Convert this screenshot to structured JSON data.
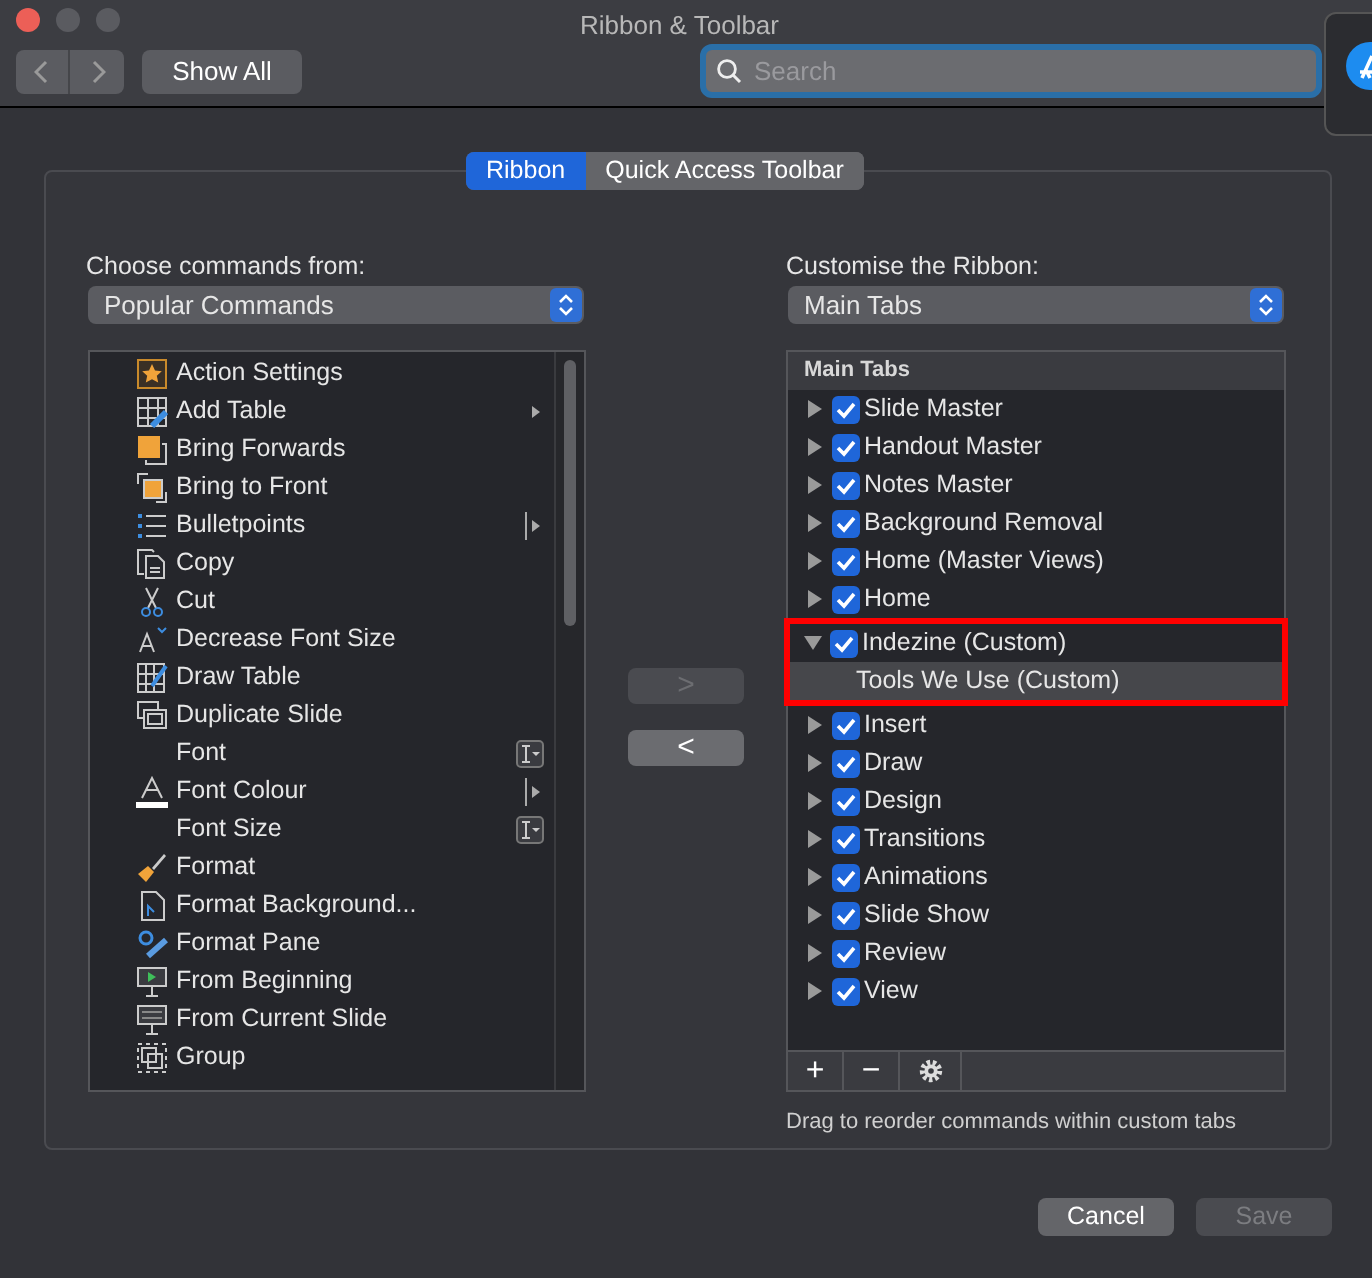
{
  "window": {
    "title": "Ribbon & Toolbar"
  },
  "toolbar": {
    "show_all": "Show All",
    "search": {
      "placeholder": "Search"
    }
  },
  "tabs": [
    {
      "label": "Ribbon",
      "selected": true
    },
    {
      "label": "Quick Access Toolbar",
      "selected": false
    }
  ],
  "left": {
    "label": "Choose commands from:",
    "dropdown": "Popular Commands",
    "commands": [
      {
        "label": "Action Settings",
        "kind": "plain",
        "selected": false
      },
      {
        "label": "Add Table",
        "kind": "submenu",
        "selected": false
      },
      {
        "label": "Bring Forwards",
        "kind": "plain",
        "selected": false
      },
      {
        "label": "Bring to Front",
        "kind": "plain",
        "selected": false
      },
      {
        "label": "Bulletpoints",
        "kind": "split",
        "selected": false
      },
      {
        "label": "Copy",
        "kind": "plain",
        "selected": false
      },
      {
        "label": "Cut",
        "kind": "plain",
        "selected": false
      },
      {
        "label": "Decrease Font Size",
        "kind": "plain",
        "selected": false
      },
      {
        "label": "Draw Table",
        "kind": "plain",
        "selected": false
      },
      {
        "label": "Duplicate Slide",
        "kind": "plain",
        "selected": false
      },
      {
        "label": "Font",
        "kind": "combo",
        "selected": false
      },
      {
        "label": "Font Colour",
        "kind": "split",
        "selected": false
      },
      {
        "label": "Font Size",
        "kind": "combo",
        "selected": false
      },
      {
        "label": "Format",
        "kind": "plain",
        "selected": false
      },
      {
        "label": "Format Background...",
        "kind": "plain",
        "selected": false
      },
      {
        "label": "Format Pane",
        "kind": "plain",
        "selected": false
      },
      {
        "label": "From Beginning",
        "kind": "plain",
        "selected": false
      },
      {
        "label": "From Current Slide",
        "kind": "plain",
        "selected": false
      },
      {
        "label": "Group",
        "kind": "plain",
        "selected": false
      }
    ]
  },
  "move_buttons": [
    {
      "label": ">",
      "disabled": true
    },
    {
      "label": "<",
      "disabled": false
    }
  ],
  "right": {
    "label": "Customise the Ribbon:",
    "dropdown": "Main Tabs",
    "header": "Main Tabs",
    "tabs": [
      {
        "label": "Slide Master",
        "checked": true,
        "expanded": false,
        "outlined": false,
        "selected": false
      },
      {
        "label": "Handout Master",
        "checked": true,
        "expanded": false,
        "outlined": false,
        "selected": false
      },
      {
        "label": "Notes Master",
        "checked": true,
        "expanded": false,
        "outlined": false,
        "selected": false
      },
      {
        "label": "Background Removal",
        "checked": true,
        "expanded": false,
        "outlined": false,
        "selected": false
      },
      {
        "label": "Home (Master Views)",
        "checked": true,
        "expanded": false,
        "outlined": false,
        "selected": false
      },
      {
        "label": "Home",
        "checked": true,
        "expanded": false,
        "outlined": false,
        "selected": false
      },
      {
        "label": "Indezine (Custom)",
        "checked": true,
        "expanded": true,
        "outlined": true,
        "selected": false,
        "children": [
          {
            "label": "Tools We Use (Custom)",
            "selected": true
          }
        ]
      },
      {
        "label": "Insert",
        "checked": true,
        "expanded": false,
        "outlined": false,
        "selected": false
      },
      {
        "label": "Draw",
        "checked": true,
        "expanded": false,
        "outlined": false,
        "selected": false
      },
      {
        "label": "Design",
        "checked": true,
        "expanded": false,
        "outlined": false,
        "selected": false
      },
      {
        "label": "Transitions",
        "checked": true,
        "expanded": false,
        "outlined": false,
        "selected": false
      },
      {
        "label": "Animations",
        "checked": true,
        "expanded": false,
        "outlined": false,
        "selected": false
      },
      {
        "label": "Slide Show",
        "checked": true,
        "expanded": false,
        "outlined": false,
        "selected": false
      },
      {
        "label": "Review",
        "checked": true,
        "expanded": false,
        "outlined": false,
        "selected": false
      },
      {
        "label": "View",
        "checked": true,
        "expanded": false,
        "outlined": false,
        "selected": false
      }
    ],
    "tools": [
      "+",
      "−"
    ],
    "hint": "Drag to reorder commands within custom tabs"
  },
  "footer": [
    {
      "label": "Cancel",
      "disabled": false
    },
    {
      "label": "Save",
      "disabled": true
    }
  ]
}
